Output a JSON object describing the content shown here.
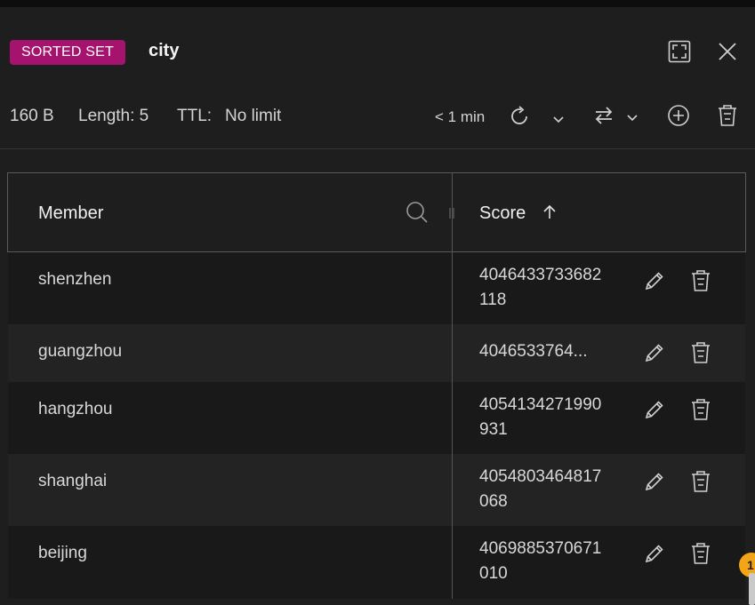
{
  "header": {
    "type_badge": "SORTED SET",
    "key_name": "city",
    "fullscreen_icon": "fullscreen-icon",
    "close_icon": "close-icon"
  },
  "meta": {
    "size": "160 B",
    "length": "Length: 5",
    "ttl_label": "TTL:",
    "ttl_value": "No limit",
    "last_refresh": "< 1 min"
  },
  "table": {
    "columns": {
      "member": "Member",
      "score": "Score"
    },
    "rows": [
      {
        "member": "shenzhen",
        "score": "4046433733682118"
      },
      {
        "member": "guangzhou",
        "score": "4046533764..."
      },
      {
        "member": "hangzhou",
        "score": "4054134271990931"
      },
      {
        "member": "shanghai",
        "score": "4054803464817068"
      },
      {
        "member": "beijing",
        "score": "4069885370671010"
      }
    ]
  },
  "notification_badge": "1",
  "colors": {
    "accent": "#a5136e",
    "background": "#1e1e1e",
    "badge": "#f2a516"
  }
}
